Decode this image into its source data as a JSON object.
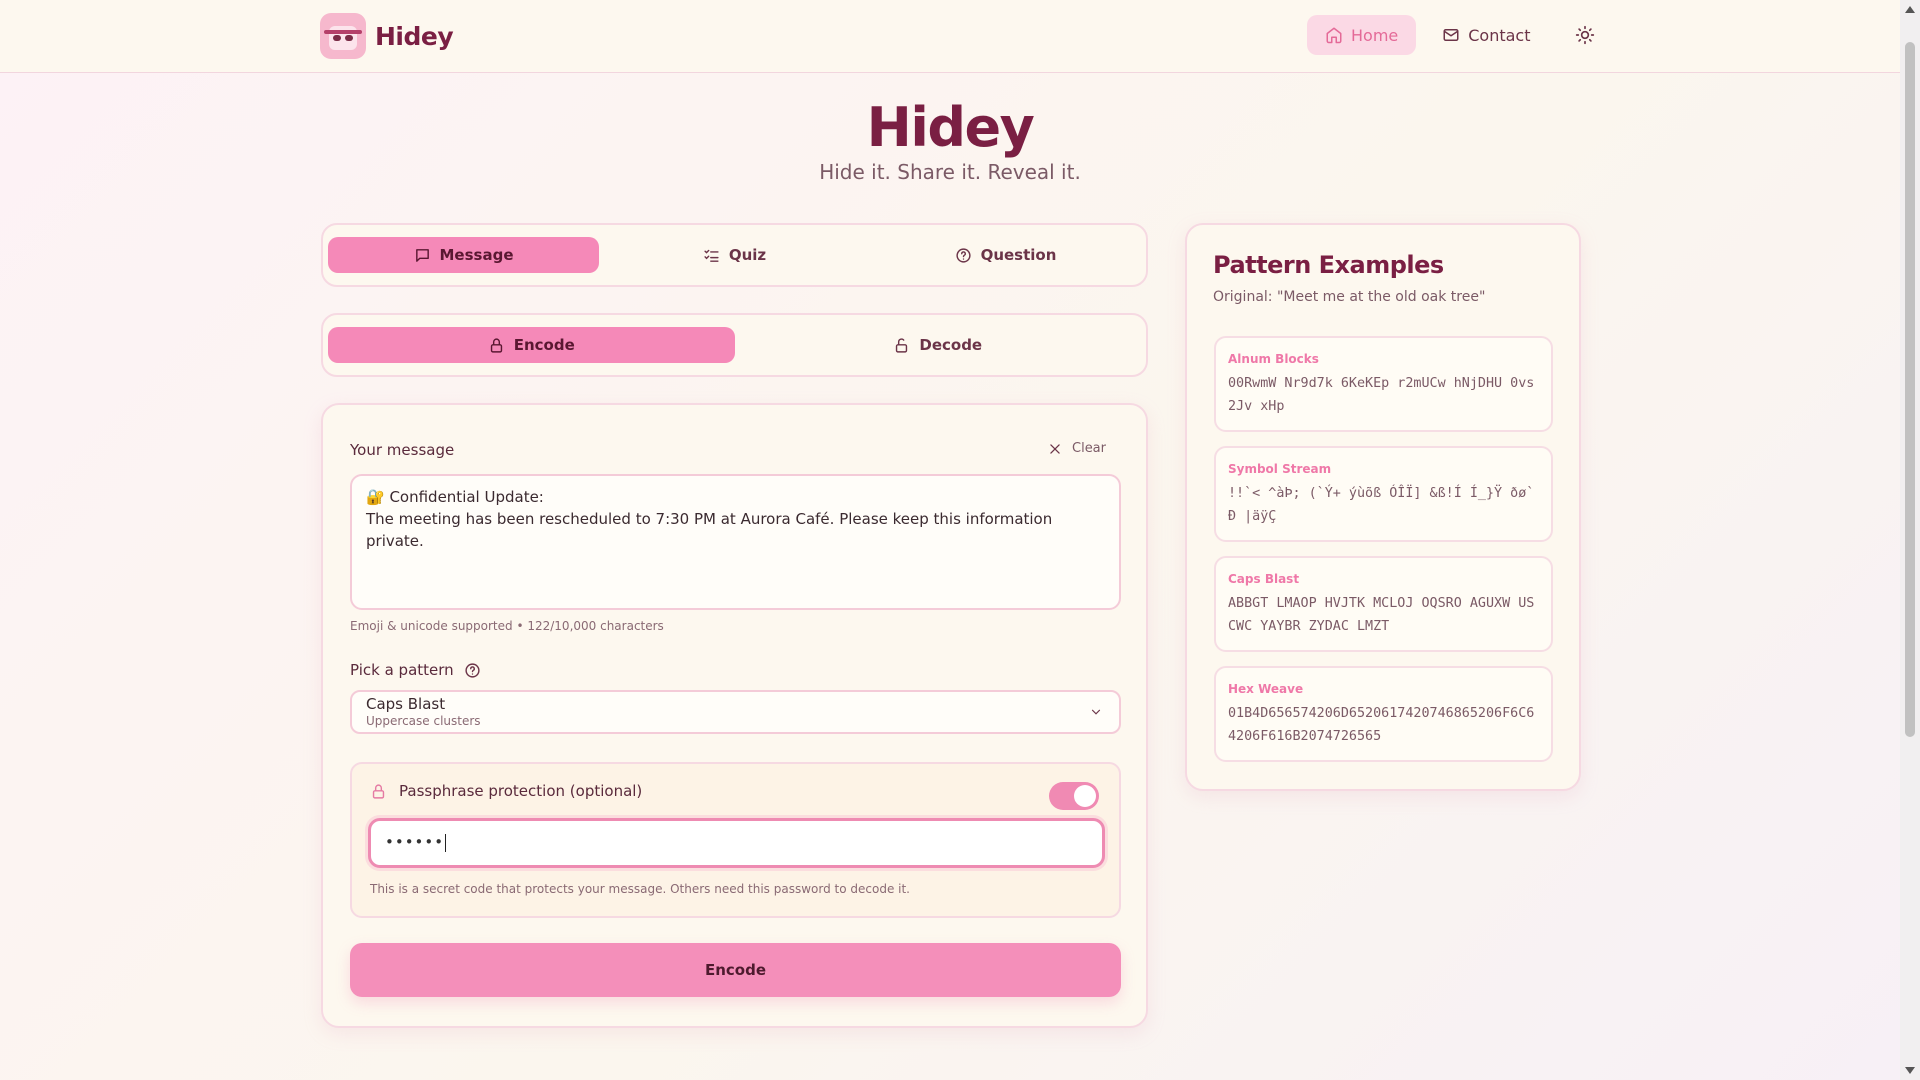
{
  "header": {
    "brand": "Hidey",
    "nav": [
      {
        "label": "Home",
        "icon": "home-icon",
        "active": true
      },
      {
        "label": "Contact",
        "icon": "mail-icon",
        "active": false
      }
    ],
    "theme_icon": "sun-icon"
  },
  "hero": {
    "title": "Hidey",
    "subtitle": "Hide it. Share it. Reveal it."
  },
  "mode_tabs": [
    {
      "label": "Message",
      "icon": "message-icon",
      "active": true
    },
    {
      "label": "Quiz",
      "icon": "list-check-icon",
      "active": false
    },
    {
      "label": "Question",
      "icon": "help-circle-icon",
      "active": false
    }
  ],
  "action_tabs": [
    {
      "label": "Encode",
      "icon": "lock-icon",
      "active": true
    },
    {
      "label": "Decode",
      "icon": "unlock-icon",
      "active": false
    }
  ],
  "form": {
    "message_label": "Your message",
    "clear_label": "Clear",
    "message_line1": "🔐 Confidential Update:",
    "message_line2": "The meeting has been rescheduled to 7:30 PM at Aurora Café. Please keep this information private.",
    "message_hint": "Emoji & unicode supported • 122/10,000 characters",
    "pattern_label": "Pick a pattern",
    "pattern_value": "Caps Blast",
    "pattern_desc": "Uppercase clusters",
    "passphrase_label": "Passphrase protection (optional)",
    "passphrase_enabled": true,
    "passphrase_value": "••••••",
    "passphrase_hint": "This is a secret code that protects your message. Others need this password to decode it.",
    "submit_label": "Encode"
  },
  "examples": {
    "title": "Pattern Examples",
    "original": "Original: \"Meet me at the old oak tree\"",
    "items": [
      {
        "name": "Alnum Blocks",
        "text": "00RwmW Nr9d7k 6KeKEp r2mUCw hNjDHU 0vs2Jv xHp"
      },
      {
        "name": "Symbol Stream",
        "text": "!!`< ^àÞ; (`Ý+ ýùõß ÓÎÏ] &ß!Í Í_}Ÿ ðø`Ð |äÿÇ"
      },
      {
        "name": "Caps Blast",
        "text": "ABBGT LMAOP HVJTK MCLOJ OQSRO AGUXW USCWC YAYBR ZYDAC LMZT"
      },
      {
        "name": "Hex Weave",
        "text": "01B4D656574206D6520617420746865206F6C64206F616B2074726565"
      }
    ]
  },
  "colors": {
    "accent": "#f589b8",
    "brand": "#7a1f43",
    "background": "#fdf8ef"
  }
}
